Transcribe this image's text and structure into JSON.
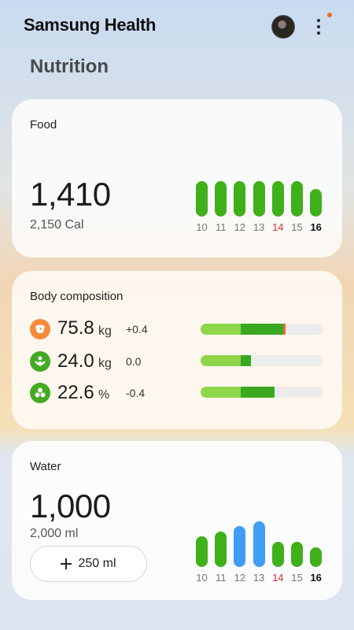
{
  "header": {
    "title": "Samsung Health"
  },
  "page": {
    "title": "Nutrition"
  },
  "food": {
    "label": "Food",
    "value": "1,410",
    "goal": "2,150 Cal",
    "days": [
      "10",
      "11",
      "12",
      "13",
      "14",
      "15",
      "16"
    ],
    "bar_levels": [
      1.0,
      1.0,
      1.0,
      1.0,
      1.0,
      1.0,
      0.78
    ],
    "bar_color": "#3fb01a",
    "weekend_day_color": "#d23030"
  },
  "body_composition": {
    "label": "Body composition",
    "metrics": [
      {
        "value": "75.8",
        "unit": "kg",
        "delta": "+0.4",
        "icon": "weight-icon",
        "icon_color": "#f58a3c",
        "light_fill": 0.33,
        "dark_fill": 0.67,
        "marker": 0.69
      },
      {
        "value": "24.0",
        "unit": "kg",
        "delta": "0.0",
        "icon": "muscle-icon",
        "icon_color": "#43ab23",
        "light_fill": 0.33,
        "dark_fill": 0.41,
        "marker": null
      },
      {
        "value": "22.6",
        "unit": "%",
        "delta": "-0.4",
        "icon": "body-fat-icon",
        "icon_color": "#43ab23",
        "light_fill": 0.33,
        "dark_fill": 0.6,
        "marker": null
      }
    ]
  },
  "water": {
    "label": "Water",
    "value": "1,000",
    "goal": "2,000 ml",
    "add_label": "250 ml",
    "days": [
      "10",
      "11",
      "12",
      "13",
      "14",
      "15",
      "16"
    ],
    "bar_levels": [
      0.67,
      0.78,
      0.9,
      1.0,
      0.55,
      0.55,
      0.43
    ],
    "bar_colors": [
      "#3fb01a",
      "#3fb01a",
      "#3f9df5",
      "#3f9df5",
      "#3fb01a",
      "#3fb01a",
      "#3fb01a"
    ]
  }
}
